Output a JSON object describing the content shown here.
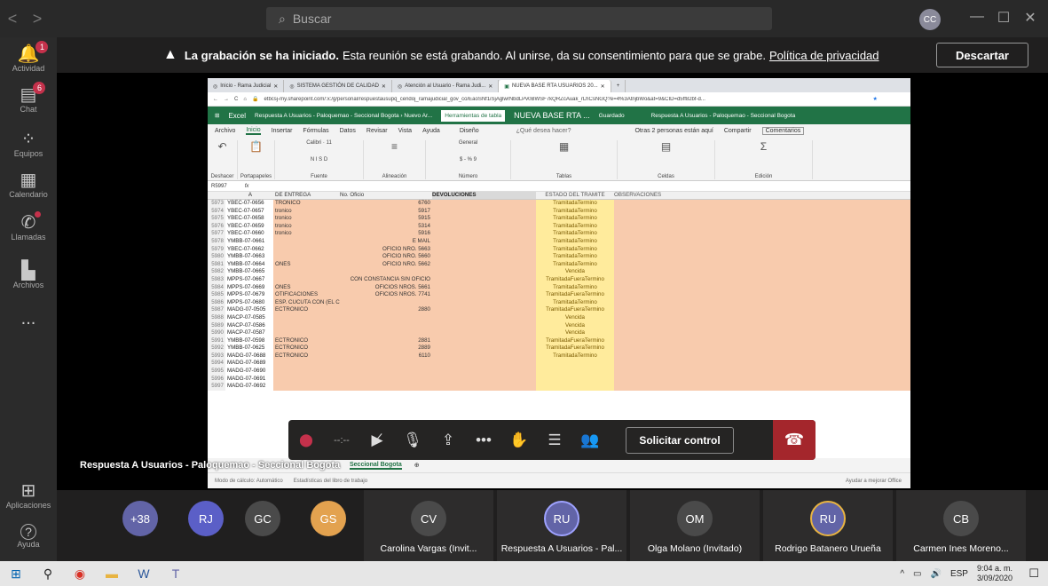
{
  "teams": {
    "nav_back": "<",
    "nav_forward": ">",
    "search_placeholder": "Buscar",
    "me_initials": "CC"
  },
  "rail": [
    {
      "label": "Actividad",
      "icon": "bell-icon",
      "glyph": "🔔",
      "badge": "1"
    },
    {
      "label": "Chat",
      "icon": "chat-icon",
      "glyph": "💬",
      "badge": "6"
    },
    {
      "label": "Equipos",
      "icon": "teams-icon",
      "glyph": "⁘"
    },
    {
      "label": "Calendario",
      "icon": "calendar-icon",
      "glyph": "▦"
    },
    {
      "label": "Llamadas",
      "icon": "phone-icon",
      "glyph": "✆"
    },
    {
      "label": "Archivos",
      "icon": "files-icon",
      "glyph": "▙"
    },
    {
      "label": "...",
      "icon": "more-icon",
      "glyph": ""
    },
    {
      "label": "Aplicaciones",
      "icon": "apps-icon",
      "glyph": "⊞"
    },
    {
      "label": "Ayuda",
      "icon": "help-icon",
      "glyph": "?"
    }
  ],
  "banner": {
    "title": "La grabación se ha iniciado.",
    "text": "Esta reunión se está grabando. Al unirse, da su consentimiento para que se grabe.",
    "link": "Política de privacidad",
    "dismiss": "Descartar"
  },
  "browser": {
    "tabs": [
      "Inicio - Rama Judicial",
      "SISTEMA GESTIÓN DE CALIDAD",
      "Atención al Usuario - Rama Judi...",
      "NUEVA BASE RTA USUARIOS 20..."
    ],
    "url": "etbcsj-my.sharepoint.com/:x:/g/personal/respuestausupq_cendoj_ramajudicial_gov_co/EaoSNf1iSjAglwrNbdLPv0BWSF7kQRZcAuak_rLhCsNGQ?e=4%3AtnjbWo&at=9&CID=d5ff82bf-d..."
  },
  "excel": {
    "app": "Excel",
    "breadcrumb": "Respuesta A Usuarios - Paloquemao - Seccional Bogota › Nuevo Ar...",
    "context_tab": "Herramientas de tabla",
    "file": "NUEVA BASE RTA ...",
    "saved": "Guardado",
    "right_title": "Respuesta A Usuarios - Paloquemao - Seccional Bogota",
    "ribbon_tabs": [
      "Archivo",
      "Inicio",
      "Insertar",
      "Fórmulas",
      "Datos",
      "Revisar",
      "Vista",
      "Ayuda",
      "Diseño"
    ],
    "tell_me": "¿Qué desea hacer?",
    "others": "Otras 2 personas están aquí",
    "share": "Compartir",
    "comments": "Comentarios",
    "groups": [
      "Deshacer",
      "Portapapeles",
      "Fuente",
      "Alineación",
      "Número",
      "Tablas",
      "Celdas",
      "Edición"
    ],
    "font_name": "Calibri",
    "font_size": "11",
    "number_format": "General",
    "cell_ref": "R5997",
    "fx": "fx",
    "col_headers": [
      "",
      "A",
      "DE ENTREGA",
      "No. Oficio",
      "DEVOLUCIONES",
      "ESTADO DEL TRAMITE",
      "OBSERVACIONES"
    ],
    "rows": [
      [
        "5973",
        "YBEC-07-0656",
        "TRONICO",
        "6760",
        "",
        "TramitadaTermino"
      ],
      [
        "5974",
        "YBEC-07-0657",
        "tronico",
        "5917",
        "",
        "TramitadaTermino"
      ],
      [
        "5975",
        "YBEC-07-0658",
        "tronico",
        "5915",
        "",
        "TramitadaTermino"
      ],
      [
        "5976",
        "YBEC-07-0659",
        "tronico",
        "5314",
        "",
        "TramitadaTermino"
      ],
      [
        "5977",
        "YBEC-07-0660",
        "tronico",
        "5916",
        "",
        "TramitadaTermino"
      ],
      [
        "5978",
        "YMBB-07-0661",
        "",
        "E MAIL",
        "",
        "TramitadaTermino"
      ],
      [
        "5979",
        "YBEC-07-0662",
        "",
        "OFICIO NRO. 5663",
        "",
        "TramitadaTermino"
      ],
      [
        "5980",
        "YMBB-07-0663",
        "",
        "OFICIO NRO. 5660",
        "",
        "TramitadaTermino"
      ],
      [
        "5981",
        "YMBB-07-0664",
        "ONES",
        "OFICIO NRO. 5662",
        "",
        "TramitadaTermino"
      ],
      [
        "5982",
        "YMBB-07-0665",
        "",
        "",
        "",
        "Vencida"
      ],
      [
        "5983",
        "MPPS-07-0667",
        "",
        "CON CONSTANCIA SIN OFICIO",
        "",
        "TramitadaFueraTermino"
      ],
      [
        "5984",
        "MPPS-07-0669",
        "ONES",
        "OFICIOS NROS. 5661",
        "",
        "TramitadaTermino"
      ],
      [
        "5985",
        "MPPS-07-0679",
        "OTIFICACIONES",
        "OFICIOS NROS. 7741",
        "",
        "TramitadaFueraTermino"
      ],
      [
        "5986",
        "MPPS-07-0680",
        "ESP. CUCUTA CON (EL CONOCIMIENTO ESTÁ ALLA",
        "",
        "",
        "TramitadaTermino"
      ],
      [
        "5987",
        "MADG-07-0505",
        "ECTRONICO",
        "2880",
        "",
        "TramitadaFueraTermino"
      ],
      [
        "5988",
        "MACP-07-0585",
        "",
        "",
        "",
        "Vencida"
      ],
      [
        "5989",
        "MACP-07-0586",
        "",
        "",
        "",
        "Vencida"
      ],
      [
        "5990",
        "MACP-07-0587",
        "",
        "",
        "",
        "Vencida"
      ],
      [
        "5991",
        "YMBB-07-0598",
        "ECTRONICO",
        "2881",
        "",
        "TramitadaFueraTermino"
      ],
      [
        "5992",
        "YMBB-07-0625",
        "ECTRONICO",
        "2889",
        "",
        "TramitadaFueraTermino"
      ],
      [
        "5993",
        "MADG-07-0688",
        "ECTRÓNICO",
        "6110",
        "",
        "TramitadaTermino"
      ],
      [
        "5994",
        "MADG-07-0689",
        "",
        "",
        "",
        ""
      ],
      [
        "5995",
        "MADG-07-0690",
        "",
        "",
        "",
        ""
      ],
      [
        "5996",
        "MADG-07-0691",
        "",
        "",
        "",
        ""
      ],
      [
        "5997",
        "MADG-07-0692",
        "",
        "",
        "",
        ""
      ]
    ],
    "sheet_tab": "Seccional Bogota",
    "status_left": "Modo de cálculo: Automático",
    "status_mid": "Estadísticas del libro de trabajo",
    "status_right": "Ayudar a mejorar Office"
  },
  "share_label": "Respuesta A Usuarios - Paloquemao - Seccional Bogota",
  "call_controls": {
    "timer": "--:--",
    "request_control": "Solicitar control"
  },
  "participants": [
    {
      "initials": "+38",
      "color": "#6264a7",
      "name": ""
    },
    {
      "initials": "RJ",
      "color": "#5b5fc7",
      "name": ""
    },
    {
      "initials": "GC",
      "color": "#4a4a4a",
      "name": ""
    },
    {
      "initials": "GS",
      "color": "#e3a24f",
      "name": ""
    },
    {
      "initials": "CV",
      "color": "#4a4a4a",
      "name": "Carolina Vargas (Invit..."
    },
    {
      "initials": "RU",
      "color": "#6264a7",
      "name": "Respuesta A Usuarios - Pal..."
    },
    {
      "initials": "OM",
      "color": "#4a4a4a",
      "name": "Olga Molano (Invitado)"
    },
    {
      "initials": "RU",
      "color": "#6264a7",
      "name": "Rodrigo Batanero Urueña"
    },
    {
      "initials": "CB",
      "color": "#4a4a4a",
      "name": "Carmen Ines Moreno..."
    }
  ],
  "taskbar": {
    "lang": "ESP",
    "time": "9:04 a. m.",
    "date": "3/09/2020"
  }
}
